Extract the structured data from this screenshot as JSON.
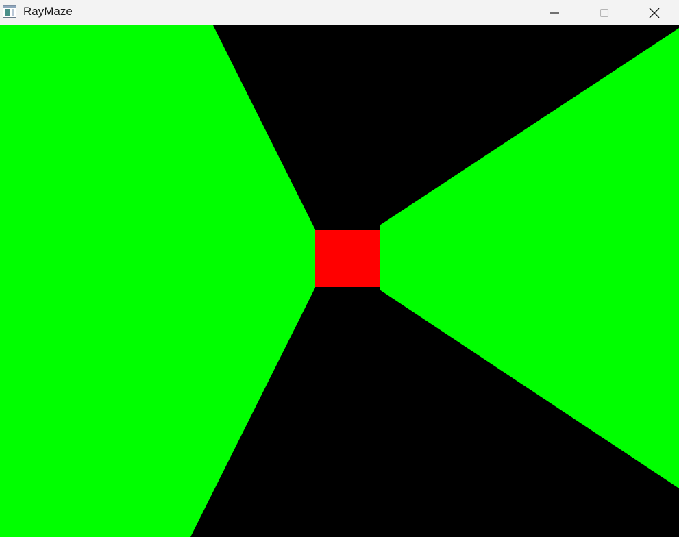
{
  "window": {
    "title": "RayMaze",
    "icon": "app-window-icon",
    "controls": [
      {
        "name": "minimize",
        "icon": "minimize-icon"
      },
      {
        "name": "maximize",
        "icon": "maximize-icon",
        "enabled": false
      },
      {
        "name": "close",
        "icon": "close-icon"
      }
    ]
  },
  "scene": {
    "background_color": "#000000",
    "wall_color": "#00ff00",
    "target_color": "#ff0000"
  }
}
